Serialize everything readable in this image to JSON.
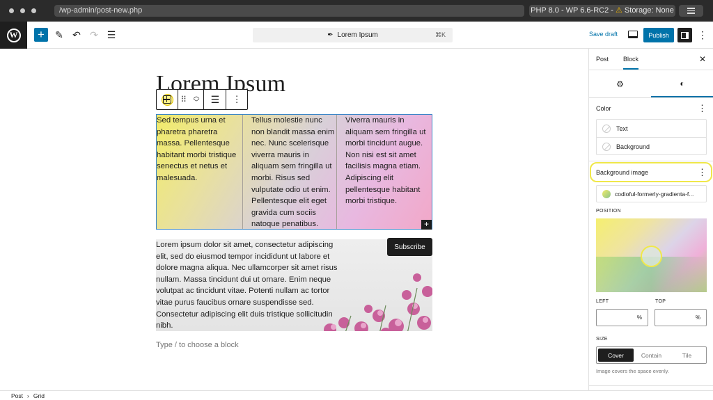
{
  "browser": {
    "url": "/wp-admin/post-new.php",
    "env_prefix": "PHP 8.0 - WP 6.6-RC2 - ",
    "warning_icon": "⚠",
    "env_storage": "Storage: None"
  },
  "header": {
    "command_title": "Lorem Ipsum",
    "shortcut": "⌘K",
    "save_draft": "Save draft",
    "publish": "Publish"
  },
  "post": {
    "title": "Lorem Ipsum",
    "columns": [
      "Sed tempus urna et pharetra pharetra massa. Pellentesque habitant morbi tristique senectus et netus et malesuada.",
      "Tellus molestie nunc non blandit massa enim nec. Nunc scelerisque viverra mauris in aliquam sem fringilla ut morbi. Risus sed vulputate odio ut enim. Pellentesque elit eget gravida cum sociis natoque penatibus.",
      "Viverra mauris in aliquam sem fringilla ut morbi tincidunt augue. Non nisi est sit amet facilisis magna etiam. Adipiscing elit pellentesque habitant morbi tristique."
    ],
    "cover_text": "Lorem ipsum dolor sit amet, consectetur adipiscing elit, sed do eiusmod tempor incididunt ut labore et dolore magna aliqua. Nec ullamcorper sit amet risus nullam. Massa tincidunt dui ut ornare. Enim neque volutpat ac tincidunt vitae. Potenti nullam ac tortor vitae purus faucibus ornare suspendisse sed. Consectetur adipiscing elit duis tristique sollicitudin nibh.",
    "subscribe": "Subscribe",
    "appender": "Type / to choose a block"
  },
  "sidebar": {
    "tab_post": "Post",
    "tab_block": "Block",
    "color_title": "Color",
    "color_text": "Text",
    "color_background": "Background",
    "bg_image_title": "Background image",
    "bg_image_file": "codioful-formerly-gradienta-f...",
    "position_label": "POSITION",
    "left_label": "LEFT",
    "top_label": "TOP",
    "left_unit": "%",
    "top_unit": "%",
    "size_label": "SIZE",
    "size_options": [
      "Cover",
      "Contain",
      "Tile"
    ],
    "size_help": "Image covers the space evenly."
  },
  "footer": {
    "crumb_post": "Post",
    "separator": "›",
    "crumb_grid": "Grid"
  },
  "colors": {
    "accent": "#0073aa",
    "highlight": "#f0e84a",
    "dark": "#1e1e1e"
  },
  "icons": {
    "inserter": "plus-icon",
    "tools": "pencil-icon",
    "undo": "undo-icon",
    "redo": "redo-icon",
    "outline": "list-view-icon",
    "settings": "gear-icon",
    "styles": "half-circle-icon"
  }
}
